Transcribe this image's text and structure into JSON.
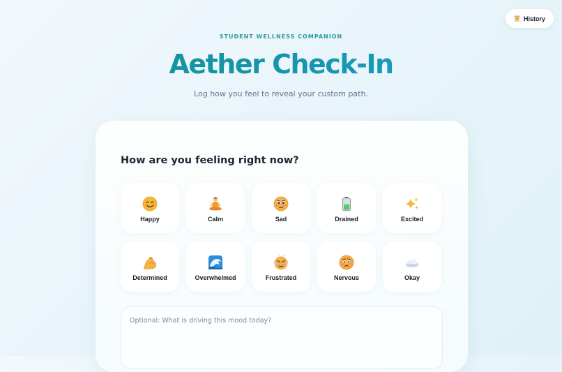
{
  "header": {
    "history_label": "History",
    "history_icon": "scroll-icon",
    "eyebrow": "STUDENT WELLNESS COMPANION",
    "title": "Aether Check-In",
    "subtitle": "Log how you feel to reveal your custom path."
  },
  "checkin": {
    "question": "How are you feeling right now?",
    "moods": [
      {
        "label": "Happy",
        "icon": "smiling-face-icon"
      },
      {
        "label": "Calm",
        "icon": "meditation-icon"
      },
      {
        "label": "Sad",
        "icon": "sad-face-icon"
      },
      {
        "label": "Drained",
        "icon": "battery-icon"
      },
      {
        "label": "Excited",
        "icon": "sparkles-icon"
      },
      {
        "label": "Determined",
        "icon": "flexed-arm-icon"
      },
      {
        "label": "Overwhelmed",
        "icon": "wave-icon"
      },
      {
        "label": "Frustrated",
        "icon": "steaming-face-icon"
      },
      {
        "label": "Nervous",
        "icon": "worried-face-icon"
      },
      {
        "label": "Okay",
        "icon": "cloud-icon"
      }
    ],
    "note_placeholder": "Optional: What is driving this mood today?"
  },
  "colors": {
    "accent": "#1592a8",
    "eyebrow": "#2a9a9e",
    "background": "#eaf5fa"
  }
}
